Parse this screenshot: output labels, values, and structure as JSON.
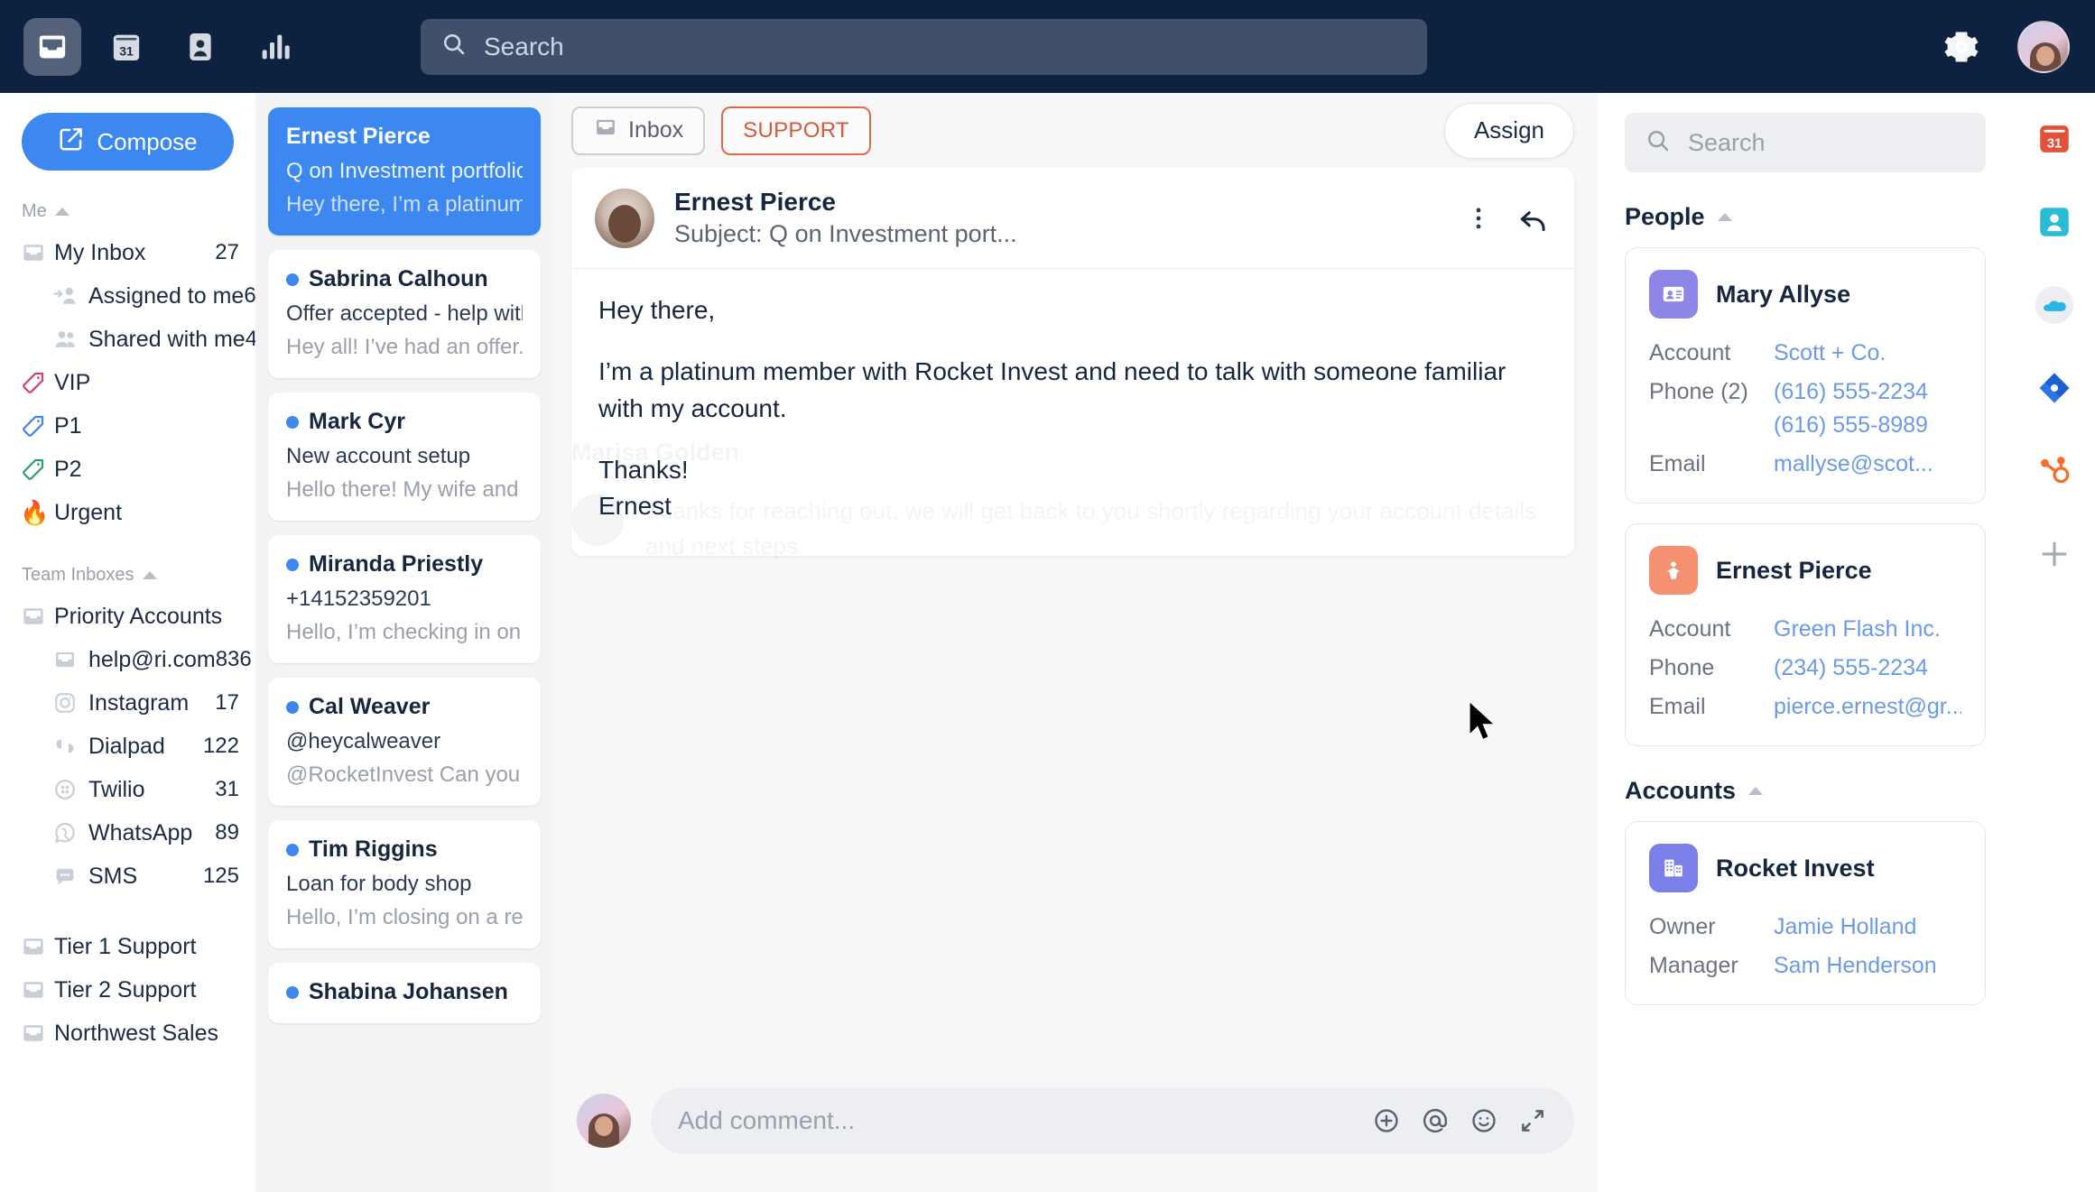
{
  "topbar": {
    "nav": [
      {
        "name": "inbox",
        "icon": "inbox-icon",
        "active": true
      },
      {
        "name": "calendar",
        "icon": "calendar-31-icon",
        "active": false
      },
      {
        "name": "contacts",
        "icon": "contact-card-icon",
        "active": false
      },
      {
        "name": "reports",
        "icon": "bar-chart-icon",
        "active": false
      }
    ],
    "search_placeholder": "Search",
    "settings_label": "Settings"
  },
  "sidebar": {
    "compose_label": "Compose",
    "sections": [
      {
        "title": "Me"
      },
      {
        "title": "Team Inboxes"
      }
    ],
    "me_items": [
      {
        "label": "My Inbox",
        "count": "27",
        "icon": "inbox-icon"
      },
      {
        "label": "Assigned to me",
        "count": "6",
        "icon": "assigned-person-icon"
      },
      {
        "label": "Shared with me",
        "count": "4",
        "icon": "people-icon"
      },
      {
        "label": "VIP",
        "count": "",
        "icon": "tag-icon",
        "color": "#d2436b"
      },
      {
        "label": "P1",
        "count": "",
        "icon": "tag-icon",
        "color": "#3d87f0"
      },
      {
        "label": "P2",
        "count": "",
        "icon": "tag-icon",
        "color": "#2e9e6b"
      },
      {
        "label": "Urgent",
        "count": "",
        "icon": "fire-emoji",
        "glyph": "🔥"
      }
    ],
    "team_items": [
      {
        "label": "Priority Accounts",
        "count": "",
        "icon": "inbox-icon"
      },
      {
        "label": "help@ri.com",
        "count": "836",
        "icon": "inbox-icon",
        "sub": true
      },
      {
        "label": "Instagram",
        "count": "17",
        "icon": "instagram-icon",
        "sub": true
      },
      {
        "label": "Dialpad",
        "count": "122",
        "icon": "dialpad-icon",
        "sub": true
      },
      {
        "label": "Twilio",
        "count": "31",
        "icon": "twilio-icon",
        "sub": true
      },
      {
        "label": "WhatsApp",
        "count": "89",
        "icon": "whatsapp-icon",
        "sub": true
      },
      {
        "label": "SMS",
        "count": "125",
        "icon": "sms-icon",
        "sub": true
      }
    ],
    "other_items": [
      {
        "label": "Tier 1 Support",
        "count": "",
        "icon": "inbox-icon"
      },
      {
        "label": "Tier 2 Support",
        "count": "",
        "icon": "inbox-icon"
      },
      {
        "label": "Northwest Sales",
        "count": "",
        "icon": "inbox-icon"
      }
    ]
  },
  "conversations": [
    {
      "name": "Ernest Pierce",
      "subject": "Q on Investment portfolio",
      "preview": "Hey there, I’m a platinum",
      "selected": true,
      "unread": false
    },
    {
      "name": "Sabrina Calhoun",
      "subject": "Offer accepted - help with wire",
      "preview": "Hey all! I’ve had an offer...",
      "selected": false,
      "unread": true
    },
    {
      "name": "Mark Cyr",
      "subject": "New account setup",
      "preview": "Hello there! My wife and I are...",
      "selected": false,
      "unread": true
    },
    {
      "name": "Miranda Priestly",
      "subject": "+14152359201",
      "preview": "Hello, I’m checking in on the",
      "selected": false,
      "unread": true
    },
    {
      "name": "Cal Weaver",
      "subject": "@heycalweaver",
      "preview": "@RocketInvest Can you please",
      "selected": false,
      "unread": true
    },
    {
      "name": "Tim Riggins",
      "subject": "Loan for body shop",
      "preview": "Hello, I’m closing on a rental...",
      "selected": false,
      "unread": true
    },
    {
      "name": "Shabina Johansen",
      "subject": "",
      "preview": "",
      "selected": false,
      "unread": true
    }
  ],
  "center": {
    "inbox_tab_label": "Inbox",
    "support_tag_label": "SUPPORT",
    "assign_label": "Assign",
    "message": {
      "sender": "Ernest Pierce",
      "subject_line": "Subject: Q on Investment port...",
      "paragraphs": [
        "Hey there,",
        "I’m a platinum member with Rocket Invest and need to talk with someone familiar with my account.",
        "Thanks!\nErnest"
      ]
    },
    "ghost": {
      "name": "Marisa Golden",
      "text": "Thanks for reaching out, we will get back to you shortly regarding your account details and next steps."
    },
    "composer_placeholder": "Add comment..."
  },
  "rightpanel": {
    "search_placeholder": "Search",
    "people_section": "People",
    "accounts_section": "Accounts",
    "people": [
      {
        "name": "Mary Allyse",
        "icon": "contact-card-icon",
        "icon_color": "#8d86e8",
        "fields": [
          {
            "key": "Account",
            "value": "Scott + Co."
          },
          {
            "key": "Phone (2)",
            "value": "(616) 555-2234",
            "value2": "(616) 555-8989"
          },
          {
            "key": "Email",
            "value": "mallyse@scot..."
          }
        ]
      },
      {
        "name": "Ernest Pierce",
        "icon": "person-star-icon",
        "icon_color": "#f59070",
        "fields": [
          {
            "key": "Account",
            "value": "Green Flash Inc."
          },
          {
            "key": "Phone",
            "value": "(234) 555-2234"
          },
          {
            "key": "Email",
            "value": "pierce.ernest@gr..."
          }
        ]
      }
    ],
    "accounts": [
      {
        "name": "Rocket Invest",
        "icon": "building-icon",
        "icon_color": "#7b80e8",
        "fields": [
          {
            "key": "Owner",
            "value": "Jamie Holland"
          },
          {
            "key": "Manager",
            "value": "Sam Henderson"
          }
        ]
      }
    ]
  },
  "rail": [
    {
      "name": "calendar-app-icon",
      "color": "#e2523a"
    },
    {
      "name": "contacts-app-icon",
      "color": "#2bbcd4"
    },
    {
      "name": "salesforce-icon",
      "color": "#2ab7e8"
    },
    {
      "name": "jira-icon",
      "color": "#2a73e8"
    },
    {
      "name": "hubspot-icon",
      "color": "#f2712c"
    },
    {
      "name": "add-integration-icon",
      "color": "#a6acb6"
    }
  ],
  "colors": {
    "accent": "#3d87f0",
    "navy": "#0d2240",
    "support": "#e0694a",
    "link": "#6a9ae8"
  }
}
